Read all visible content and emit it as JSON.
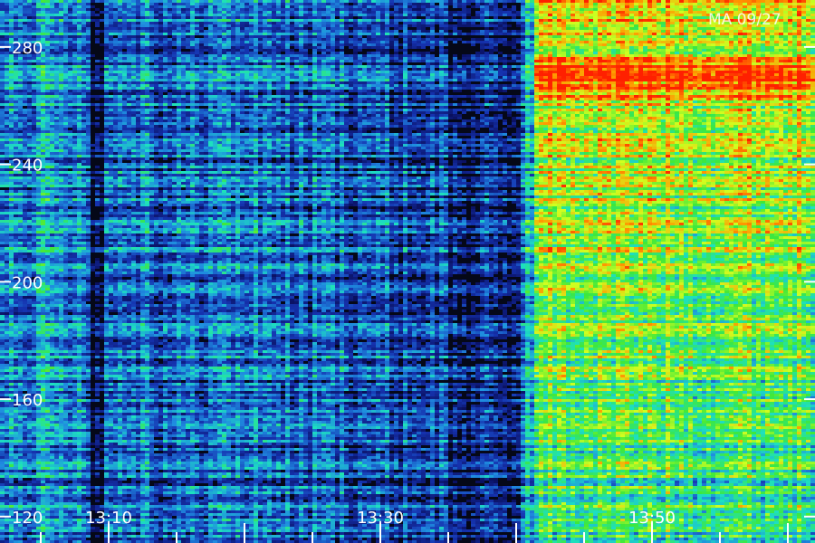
{
  "chart_data": {
    "type": "heatmap",
    "title": "",
    "xlabel": "",
    "ylabel": "",
    "stamp": "MA 09/27",
    "x_axis": {
      "range": [
        "13:02",
        "13:61"
      ],
      "tick_labels": [
        {
          "time": "13:10",
          "value": 10
        },
        {
          "time": "13:30",
          "value": 30
        },
        {
          "time": "13:50",
          "value": 50
        }
      ],
      "minor_tick_step_minutes": 5
    },
    "y_axis": {
      "range": [
        111,
        296
      ],
      "tick_labels": [
        {
          "text": "280",
          "value": 280
        },
        {
          "text": "240",
          "value": 240
        },
        {
          "text": "200",
          "value": 200
        },
        {
          "text": "160",
          "value": 160
        },
        {
          "text": "120",
          "value": 120
        }
      ]
    },
    "intensity_segments": [
      {
        "start": 2,
        "end": 8.7,
        "level": 0.38
      },
      {
        "start": 8.7,
        "end": 9.8,
        "level": 0.1
      },
      {
        "start": 9.8,
        "end": 11.5,
        "level": 0.33
      },
      {
        "start": 11.5,
        "end": 13.3,
        "level": 0.36
      },
      {
        "start": 13.3,
        "end": 16.6,
        "level": 0.3
      },
      {
        "start": 16.6,
        "end": 22.8,
        "level": 0.34
      },
      {
        "start": 22.8,
        "end": 29.2,
        "level": 0.3
      },
      {
        "start": 29.2,
        "end": 35.1,
        "level": 0.26
      },
      {
        "start": 35.1,
        "end": 40.4,
        "level": 0.18
      },
      {
        "start": 40.4,
        "end": 41.2,
        "level": 0.42
      },
      {
        "start": 41.2,
        "end": 62,
        "level": 0.66
      }
    ],
    "colormap": [
      "#000000",
      "#0a1060",
      "#1533b0",
      "#1f8be0",
      "#1de0c0",
      "#3ee83a",
      "#d0ff20",
      "#ff9a00",
      "#ff2000"
    ],
    "grid": false,
    "legend": "none"
  }
}
